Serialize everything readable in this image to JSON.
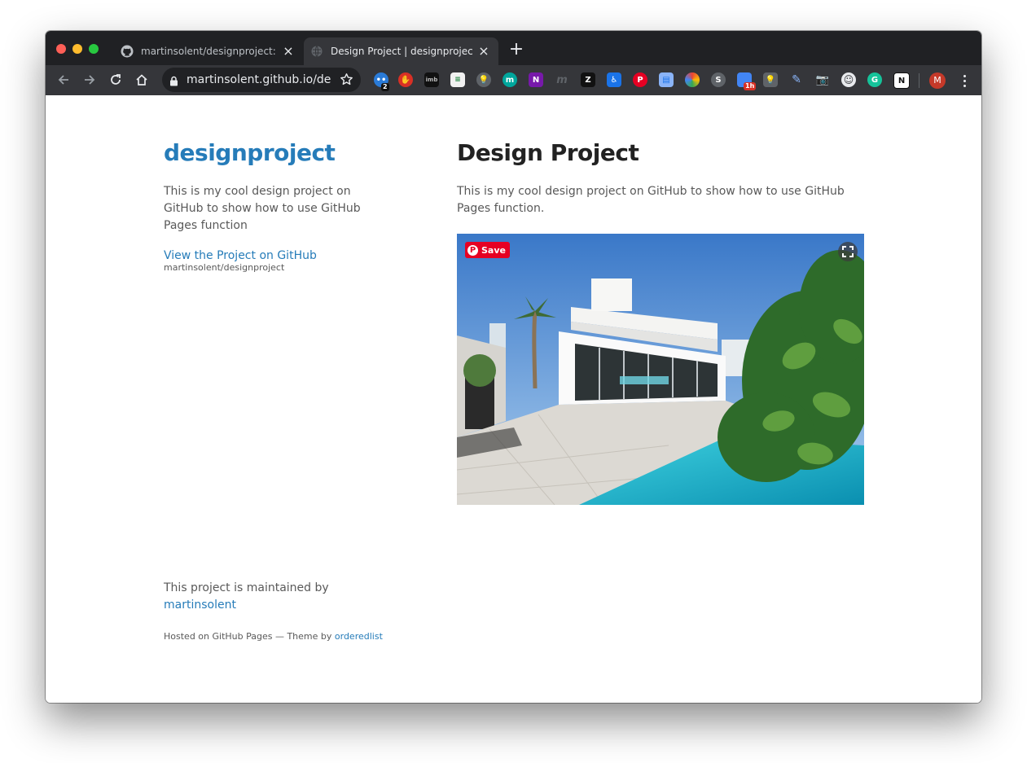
{
  "browser": {
    "tabs": [
      {
        "title": "martinsolent/designproject: This",
        "active": false,
        "favicon": "github-icon"
      },
      {
        "title": "Design Project | designproject",
        "active": true,
        "favicon": "globe-icon"
      }
    ],
    "url": "martinsolent.github.io/de...",
    "profile_initial": "M",
    "extensions": [
      {
        "name": "puzzle-ext",
        "badge": "2"
      },
      {
        "name": "stop-hand-ext"
      },
      {
        "name": "imdb-ext"
      },
      {
        "name": "sheets-ext"
      },
      {
        "name": "lightbulb-ext"
      },
      {
        "name": "m-ext"
      },
      {
        "name": "onenote-ext"
      },
      {
        "name": "m-gray-ext"
      },
      {
        "name": "zebra-ext"
      },
      {
        "name": "accessibility-ext"
      },
      {
        "name": "pinterest-ext"
      },
      {
        "name": "docs-ext"
      },
      {
        "name": "colorwheel-ext"
      },
      {
        "name": "skype-ext"
      },
      {
        "name": "calendar-ext",
        "badge": "1h"
      },
      {
        "name": "keep-ext"
      },
      {
        "name": "notes-ext"
      },
      {
        "name": "camera-ext"
      },
      {
        "name": "smiley-ext"
      },
      {
        "name": "grammarly-ext"
      },
      {
        "name": "notion-ext"
      }
    ]
  },
  "sidebar": {
    "title": "designproject",
    "description": "This is my cool design project on GitHub to show how to use GitHub Pages function",
    "github_link": "View the Project on GitHub",
    "github_repo": "martinsolent/designproject"
  },
  "main": {
    "heading": "Design Project",
    "lead": "This is my cool design project on GitHub to show how to use GitHub Pages function.",
    "pinterest_save": "Save"
  },
  "footer": {
    "maintained_prefix": "This project is maintained by",
    "maintainer": "martinsolent",
    "hosted_prefix": "Hosted on GitHub Pages — Theme by",
    "theme_author": "orderedlist"
  },
  "colors": {
    "link": "#267CB9",
    "text": "#595959",
    "heading": "#222222",
    "chrome_dark": "#202124",
    "chrome_toolbar": "#35363a",
    "pinterest": "#e60023"
  }
}
